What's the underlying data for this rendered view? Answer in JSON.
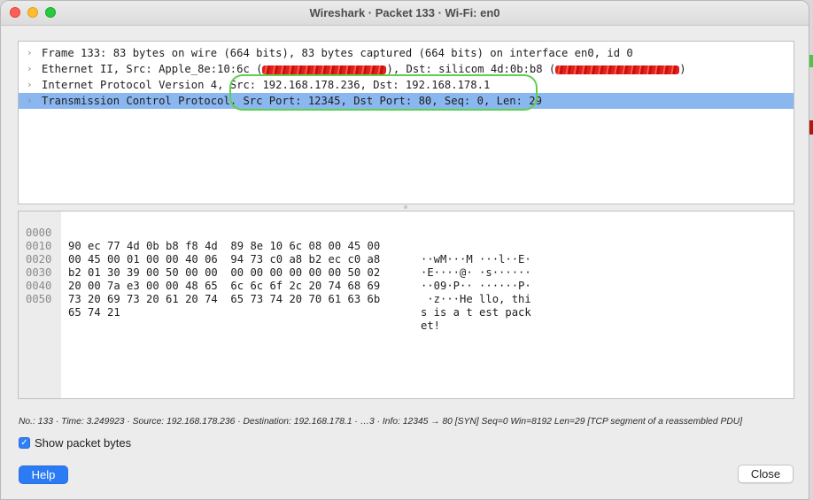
{
  "window": {
    "title": "Wireshark · Packet 133 · Wi-Fi: en0"
  },
  "tree": {
    "rows": [
      {
        "text": "Frame 133: 83 bytes on wire (664 bits), 83 bytes captured (664 bits) on interface en0, id 0"
      },
      {
        "text_a": "Ethernet II, Src: Apple_8e:10:6c (",
        "text_b": "), Dst: silicom_4d:0b:b8 (",
        "text_c": ")"
      },
      {
        "text": "Internet Protocol Version 4, Src: 192.168.178.236, Dst: 192.168.178.1"
      },
      {
        "text": "Transmission Control Protocol, Src Port: 12345, Dst Port: 80, Seq: 0, Len: 29"
      }
    ],
    "selected_index": 3
  },
  "bytes": {
    "rows": [
      {
        "offset": "0000",
        "hex": "90 ec 77 4d 0b b8 f8 4d  89 8e 10 6c 08 00 45 00",
        "ascii": "··wM···M ···l··E·"
      },
      {
        "offset": "0010",
        "hex": "00 45 00 01 00 00 40 06  94 73 c0 a8 b2 ec c0 a8",
        "ascii": "·E····@· ·s······"
      },
      {
        "offset": "0020",
        "hex": "b2 01 30 39 00 50 00 00  00 00 00 00 00 00 50 02",
        "ascii": "··09·P·· ······P·"
      },
      {
        "offset": "0030",
        "hex": "20 00 7a e3 00 00 48 65  6c 6c 6f 2c 20 74 68 69",
        "ascii": " ·z···He llo, thi"
      },
      {
        "offset": "0040",
        "hex": "73 20 69 73 20 61 20 74  65 73 74 20 70 61 63 6b",
        "ascii": "s is a t est pack"
      },
      {
        "offset": "0050",
        "hex": "65 74 21",
        "ascii": "et!"
      }
    ]
  },
  "status_text": "No.: 133 · Time: 3.249923 · Source: 192.168.178.236 · Destination: 192.168.178.1 · …3 · Info: 12345 → 80 [SYN] Seq=0 Win=8192 Len=29 [TCP segment of a reassembled PDU]",
  "show_bytes": {
    "label": "Show packet bytes",
    "checked": true
  },
  "buttons": {
    "help": "Help",
    "close": "Close"
  },
  "colors": {
    "selection": "#8bb7f0",
    "accent": "#2b7cf4",
    "annotation": "#5cd14a",
    "redaction": "#e02020"
  }
}
